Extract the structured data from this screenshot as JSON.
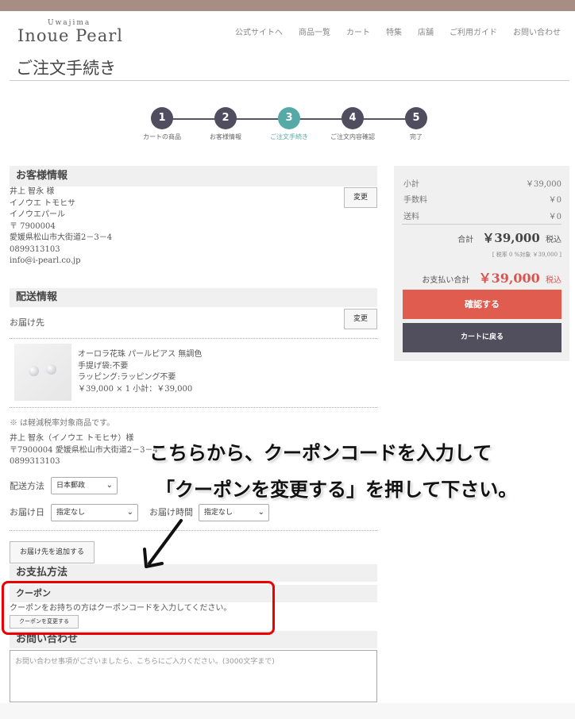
{
  "header": {
    "logo_small": "Uwajima",
    "logo": "Inoue Pearl",
    "nav": [
      "公式サイトへ",
      "商品一覧",
      "カート",
      "特集",
      "店舗",
      "ご利用ガイド",
      "お問い合わせ"
    ]
  },
  "page_title": "ご注文手続き",
  "steps": [
    {
      "num": "1",
      "label": "カートの商品"
    },
    {
      "num": "2",
      "label": "お客様情報"
    },
    {
      "num": "3",
      "label": "ご注文手続き"
    },
    {
      "num": "4",
      "label": "ご注文内容確認"
    },
    {
      "num": "5",
      "label": "完了"
    }
  ],
  "customer": {
    "heading": "お客様情報",
    "name": "井上 智永 様",
    "kana": "イノウエ トモヒサ",
    "company": "イノウエパール",
    "zip": "〒 7900004",
    "address": "愛媛県松山市大街道2－3－4",
    "phone": "0899313103",
    "email": "info@i-pearl.co.jp",
    "change_label": "変更"
  },
  "delivery": {
    "heading": "配送情報",
    "destination_label": "お届け先",
    "change_label": "変更",
    "product_name": "オーロラ花珠 パールピアス 無調色",
    "bag": "手提げ袋:不要",
    "wrapping": "ラッピング:ラッピング不要",
    "price_line": "￥39,000 × 1  小計：￥39,000",
    "tax_note": "※ は軽減税率対象商品です。",
    "recipient_name": "井上 智永（イノウエ トモヒサ）様",
    "recipient_address": "〒7900004 愛媛県松山市大街道2－3－4",
    "recipient_phone": "0899313103",
    "method_label": "配送方法",
    "method_value": "日本郵政",
    "date_label": "お届け日",
    "date_value": "指定なし",
    "time_label": "お届け時間",
    "time_value": "指定なし",
    "add_destination_label": "お届け先を追加する"
  },
  "payment": {
    "heading": "お支払方法"
  },
  "coupon": {
    "heading": "クーポン",
    "note": "クーポンをお持ちの方はクーポンコードを入力してください。",
    "button_label": "クーポンを変更する"
  },
  "inquiry": {
    "heading": "お問い合わせ",
    "placeholder": "お問い合わせ事項がございましたら、こちらにご入力ください。(3000文字まで)"
  },
  "summary": {
    "subtotal_label": "小計",
    "subtotal_value": "￥39,000",
    "fee_label": "手数料",
    "fee_value": "￥0",
    "shipping_label": "送料",
    "shipping_value": "￥0",
    "total_label": "合計",
    "total_value": "￥39,000",
    "tax_in": "税込",
    "tax_breakdown": "[ 税率 0 %対象  ￥39,000 ]",
    "payment_label": "お支払い合計",
    "payment_value": "￥39,000",
    "payment_tax_in": "税込",
    "confirm_label": "確認する",
    "back_label": "カートに戻る"
  },
  "annotation": {
    "line1": "こちらから、クーポンコードを入力して",
    "line2": "「クーポンを変更する」を押して下さい。"
  },
  "colors": {
    "accent_teal": "#55aaa8",
    "confirm_red": "#e05c4f",
    "dark_button": "#514f5e",
    "price_red": "#d9534f"
  }
}
